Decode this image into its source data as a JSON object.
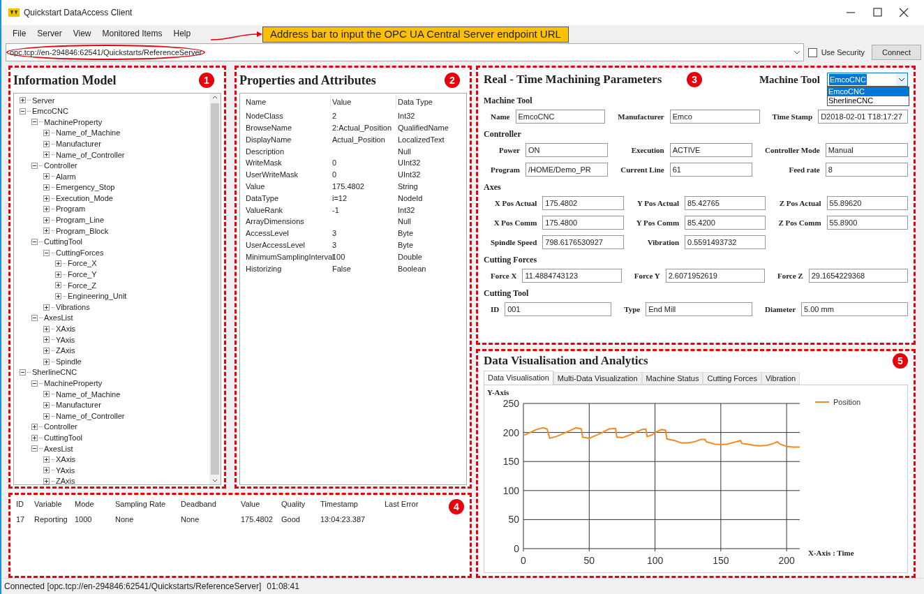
{
  "window": {
    "title": "Quickstart DataAccess Client"
  },
  "menu": [
    "File",
    "Server",
    "View",
    "Monitored Items",
    "Help"
  ],
  "address": {
    "value": "opc.tcp://en-294846:62541/Quickstarts/ReferenceServer",
    "use_security": {
      "label": "Use Security",
      "checked": false
    },
    "connect": "Connect"
  },
  "callout": {
    "text": "Address bar to input the OPC UA Central Server endpoint URL"
  },
  "information_model": {
    "title": "Information Model",
    "badge": "1",
    "tree": [
      {
        "label": "Server",
        "expanded": false
      },
      {
        "label": "EmcoCNC",
        "expanded": true,
        "children": [
          {
            "label": "MachineProperty",
            "expanded": true,
            "children": [
              {
                "label": "Name_of_Machine",
                "expanded": false
              },
              {
                "label": "Manufacturer",
                "expanded": false
              },
              {
                "label": "Name_of_Controller",
                "expanded": false
              }
            ]
          },
          {
            "label": "Controller",
            "expanded": true,
            "children": [
              {
                "label": "Alarm",
                "expanded": false
              },
              {
                "label": "Emergency_Stop",
                "expanded": false
              },
              {
                "label": "Execution_Mode",
                "expanded": false
              },
              {
                "label": "Program",
                "expanded": false
              },
              {
                "label": "Program_Line",
                "expanded": false
              },
              {
                "label": "Program_Block",
                "expanded": false
              }
            ]
          },
          {
            "label": "CuttingTool",
            "expanded": true,
            "children": [
              {
                "label": "CuttingForces",
                "expanded": true,
                "children": [
                  {
                    "label": "Force_X",
                    "expanded": false
                  },
                  {
                    "label": "Force_Y",
                    "expanded": false
                  },
                  {
                    "label": "Force_Z",
                    "expanded": false
                  },
                  {
                    "label": "Engineering_Unit",
                    "expanded": false
                  }
                ]
              },
              {
                "label": "Vibrations",
                "expanded": false
              }
            ]
          },
          {
            "label": "AxesList",
            "expanded": true,
            "children": [
              {
                "label": "XAxis",
                "expanded": false
              },
              {
                "label": "YAxis",
                "expanded": false
              },
              {
                "label": "ZAxis",
                "expanded": false
              },
              {
                "label": "Spindle",
                "expanded": false
              }
            ]
          }
        ]
      },
      {
        "label": "SherlineCNC",
        "expanded": true,
        "children": [
          {
            "label": "MachineProperty",
            "expanded": true,
            "children": [
              {
                "label": "Name_of_Machine",
                "expanded": false
              },
              {
                "label": "Manufacturer",
                "expanded": false
              },
              {
                "label": "Name_of_Controller",
                "expanded": false
              }
            ]
          },
          {
            "label": "Controller",
            "expanded": false
          },
          {
            "label": "CuttingTool",
            "expanded": false
          },
          {
            "label": "AxesList",
            "expanded": true,
            "children": [
              {
                "label": "XAxis",
                "expanded": false
              },
              {
                "label": "YAxis",
                "expanded": false
              },
              {
                "label": "ZAxis",
                "expanded": false
              }
            ]
          }
        ]
      }
    ]
  },
  "properties": {
    "title": "Properties and Attributes",
    "badge": "2",
    "columns": [
      "Name",
      "Value",
      "Data Type"
    ],
    "rows": [
      [
        "NodeClass",
        "2",
        "Int32"
      ],
      [
        "BrowseName",
        "2:Actual_Position",
        "QualifiedName"
      ],
      [
        "DisplayName",
        "Actual_Position",
        "LocalizedText"
      ],
      [
        "Description",
        "",
        "Null"
      ],
      [
        "WriteMask",
        "0",
        "UInt32"
      ],
      [
        "UserWriteMask",
        "0",
        "UInt32"
      ],
      [
        "Value",
        "175.4802",
        "String"
      ],
      [
        "DataType",
        "i=12",
        "NodeId"
      ],
      [
        "ValueRank",
        "-1",
        "Int32"
      ],
      [
        "ArrayDimensions",
        "",
        "Null"
      ],
      [
        "AccessLevel",
        "3",
        "Byte"
      ],
      [
        "UserAccessLevel",
        "3",
        "Byte"
      ],
      [
        "MinimumSamplingInterval",
        "100",
        "Double"
      ],
      [
        "Historizing",
        "False",
        "Boolean"
      ]
    ]
  },
  "realtime": {
    "title": "Real - Time Machining Parameters",
    "badge": "3",
    "selector_label": "Machine Tool",
    "selector": {
      "value": "EmcoCNC",
      "options": [
        {
          "label": "EmcoCNC",
          "selected": true
        },
        {
          "label": "SherlineCNC",
          "selected": false
        }
      ]
    },
    "sections": [
      {
        "title": "Machine Tool",
        "fields": [
          {
            "label": "Name",
            "value": "EmcoCNC"
          },
          {
            "label": "Manufacturer",
            "value": "Emco"
          },
          {
            "label": "Time Stamp",
            "value": "D2018-02-01 T18:17:27"
          }
        ]
      },
      {
        "title": "Controller",
        "fields": [
          {
            "label": "Power",
            "value": "ON"
          },
          {
            "label": "Execution",
            "value": "ACTIVE"
          },
          {
            "label": "Controller Mode",
            "value": "Manual"
          },
          {
            "label": "Program",
            "value": "/HOME/Demo_PR"
          },
          {
            "label": "Current Line",
            "value": "61"
          },
          {
            "label": "Feed rate",
            "value": "8"
          }
        ]
      },
      {
        "title": "Axes",
        "fields": [
          {
            "label": "X Pos Actual",
            "value": "175.4802"
          },
          {
            "label": "Y Pos Actual",
            "value": "85.42765"
          },
          {
            "label": "Z Pos Actual",
            "value": "55.89620"
          },
          {
            "label": "X Pos Comm",
            "value": "175.4800"
          },
          {
            "label": "Y Pos Comm",
            "value": "85.4200"
          },
          {
            "label": "Z Pos Comm",
            "value": "55.8900"
          },
          {
            "label": "Spindle Speed",
            "value": "798.6176530927"
          },
          {
            "label": "Vibration",
            "value": "0.5591493732"
          }
        ]
      },
      {
        "title": "Cutting Forces",
        "fields": [
          {
            "label": "Force X",
            "value": "11.4884743123"
          },
          {
            "label": "Force Y",
            "value": "2.6071952619"
          },
          {
            "label": "Force Z",
            "value": "29.1654229368"
          }
        ]
      },
      {
        "title": "Cutting Tool",
        "fields": [
          {
            "label": "ID",
            "value": "001"
          },
          {
            "label": "Type",
            "value": "End Mill"
          },
          {
            "label": "Diameter",
            "value": "5.00 mm"
          }
        ]
      }
    ]
  },
  "monitored_items": {
    "badge": "4",
    "columns": [
      "ID",
      "Variable",
      "Mode",
      "Sampling Rate",
      "Deadband",
      "Value",
      "Quality",
      "Timestamp",
      "Last Error"
    ],
    "rows": [
      [
        "17",
        "Reporting",
        "1000",
        "None",
        "None",
        "175.4802",
        "Good",
        "13:04:23.387",
        ""
      ]
    ]
  },
  "analytics": {
    "title": "Data Visualisation and Analytics",
    "badge": "5",
    "tabs": [
      {
        "label": "Data Visualisation",
        "selected": true
      },
      {
        "label": "Multi-Data Visualization",
        "selected": false
      },
      {
        "label": "Machine Status",
        "selected": false
      },
      {
        "label": "Cutting Forces",
        "selected": false
      },
      {
        "label": "Vibration",
        "selected": false
      }
    ],
    "chart_data": {
      "type": "line",
      "grid": true,
      "ylabel": "Y-Axis",
      "xlabel": "X-Axis : Time",
      "xlim": [
        0,
        210
      ],
      "ylim": [
        0,
        250
      ],
      "xticks": [
        0,
        50,
        100,
        150,
        200
      ],
      "yticks": [
        0,
        50,
        100,
        150,
        200,
        250
      ],
      "x": [
        0,
        5,
        10,
        15,
        18,
        20,
        25,
        30,
        35,
        40,
        44,
        45,
        50,
        55,
        60,
        65,
        70,
        71,
        75,
        80,
        85,
        90,
        93,
        94,
        98,
        100,
        105,
        108,
        109,
        115,
        120,
        125,
        130,
        135,
        138,
        139,
        145,
        150,
        155,
        160,
        165,
        166,
        170,
        175,
        180,
        185,
        190,
        193,
        195,
        200,
        205,
        210
      ],
      "series": [
        {
          "name": "Position",
          "color": "#f5891f",
          "values": [
            195,
            200,
            205,
            208,
            206,
            190,
            193,
            198,
            203,
            208,
            206,
            192,
            190,
            195,
            200,
            206,
            207,
            192,
            191,
            195,
            200,
            205,
            206,
            193,
            196,
            200,
            205,
            204,
            189,
            186,
            182,
            182,
            184,
            188,
            188,
            184,
            180,
            179,
            180,
            183,
            186,
            181,
            180,
            178,
            177,
            178,
            181,
            184,
            180,
            176,
            175,
            175
          ]
        }
      ]
    }
  },
  "status_bar": {
    "text": "Connected [opc.tcp://en-294846:62541/Quickstarts/ReferenceServer]",
    "time": "01:08:41"
  }
}
